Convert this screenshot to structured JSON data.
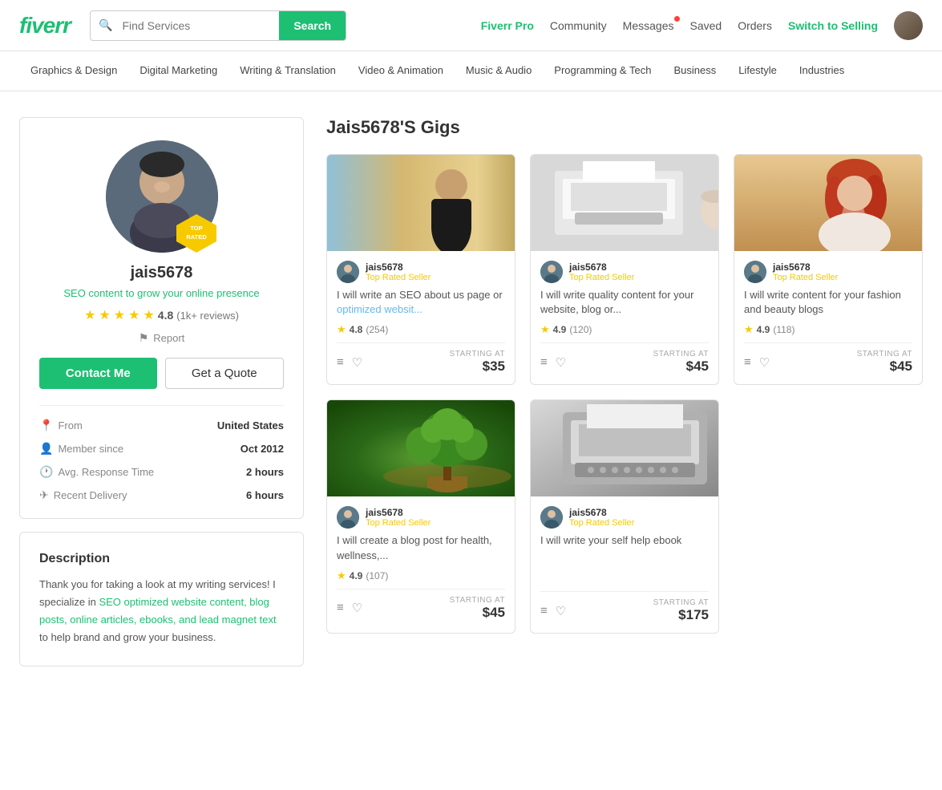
{
  "header": {
    "logo": "fiverr",
    "search_placeholder": "Find Services",
    "search_btn": "Search",
    "nav": [
      {
        "label": "Fiverr Pro",
        "key": "fiverr-pro",
        "class": "fiverr-pro"
      },
      {
        "label": "Community",
        "key": "community"
      },
      {
        "label": "Messages",
        "key": "messages",
        "dot": true
      },
      {
        "label": "Saved",
        "key": "saved"
      },
      {
        "label": "Orders",
        "key": "orders"
      },
      {
        "label": "Switch to Selling",
        "key": "switch-selling",
        "class": "switch-selling"
      }
    ]
  },
  "categories": [
    {
      "label": "Graphics & Design",
      "key": "graphics-design"
    },
    {
      "label": "Digital Marketing",
      "key": "digital-marketing"
    },
    {
      "label": "Writing & Translation",
      "key": "writing-translation"
    },
    {
      "label": "Video & Animation",
      "key": "video-animation"
    },
    {
      "label": "Music & Audio",
      "key": "music-audio"
    },
    {
      "label": "Programming & Tech",
      "key": "programming-tech"
    },
    {
      "label": "Business",
      "key": "business"
    },
    {
      "label": "Lifestyle",
      "key": "lifestyle"
    },
    {
      "label": "Industries",
      "key": "industries"
    }
  ],
  "profile": {
    "username": "jais5678",
    "tagline": "SEO content to grow your online presence",
    "rating": "4.8",
    "reviews": "(1k+ reviews)",
    "badge_line1": "TOP",
    "badge_line2": "RATED",
    "report": "Report",
    "btn_contact": "Contact Me",
    "btn_quote": "Get a Quote",
    "details": [
      {
        "icon": "📍",
        "label": "From",
        "value": "United States"
      },
      {
        "icon": "👤",
        "label": "Member since",
        "value": "Oct 2012"
      },
      {
        "icon": "🕐",
        "label": "Avg. Response Time",
        "value": "2 hours"
      },
      {
        "icon": "✈",
        "label": "Recent Delivery",
        "value": "6 hours"
      }
    ]
  },
  "description": {
    "title": "Description",
    "text": "Thank you for taking a look at my writing services! I specialize in SEO optimized website content, blog posts, online articles, ebooks, and lead magnet text to help brand and grow your business."
  },
  "gigs_title": "Jais5678'S Gigs",
  "gigs": [
    {
      "id": 1,
      "thumb_class": "gig-thumb-1",
      "seller": "jais5678",
      "level": "Top Rated Seller",
      "title_plain": "I will write an SEO about us page or optimized websit...",
      "title_link": "optimized websit...",
      "rating": "4.8",
      "reviews": "254",
      "price": "$35"
    },
    {
      "id": 2,
      "thumb_class": "gig-thumb-2",
      "seller": "jais5678",
      "level": "Top Rated Seller",
      "title_plain": "I will write quality content for your website, blog or...",
      "rating": "4.9",
      "reviews": "120",
      "price": "$45"
    },
    {
      "id": 3,
      "thumb_class": "gig-thumb-3",
      "seller": "jais5678",
      "level": "Top Rated Seller",
      "title_plain": "I will write content for your fashion and beauty blogs",
      "rating": "4.9",
      "reviews": "118",
      "price": "$45"
    },
    {
      "id": 4,
      "thumb_class": "gig-thumb-4",
      "seller": "jais5678",
      "level": "Top Rated Seller",
      "title_plain": "I will create a blog post for health, wellness,...",
      "rating": "4.9",
      "reviews": "107",
      "price": "$45"
    },
    {
      "id": 5,
      "thumb_class": "gig-thumb-5",
      "seller": "jais5678",
      "level": "Top Rated Seller",
      "title_plain": "I will write your self help ebook",
      "rating": null,
      "reviews": null,
      "price": "$175"
    }
  ]
}
